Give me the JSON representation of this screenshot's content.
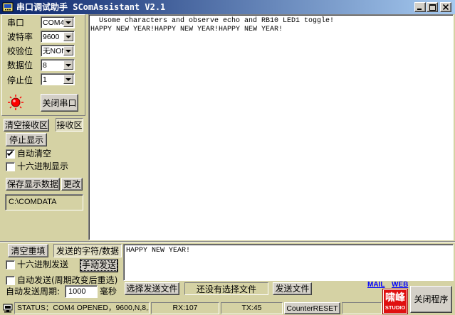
{
  "window": {
    "title": "串口调试助手 SComAssistant V2.1"
  },
  "icons": {
    "app": "app-icon",
    "minimize": "minimize-icon",
    "maximize": "maximize-icon",
    "close": "close-icon",
    "dropdown": "dropdown-arrow-icon",
    "led": "led-indicator-icon",
    "checkmark": "checkmark-icon",
    "status": "status-icon"
  },
  "colors": {
    "panel": "#d5d2a4",
    "button_face": "#d4d0c8",
    "title_start": "#0a246a",
    "title_end": "#a6caf0",
    "led": "#ff0000",
    "link": "#0000ff",
    "logo": "#e01010"
  },
  "port_settings": {
    "fields": [
      {
        "label": "串口",
        "value": "COM4"
      },
      {
        "label": "波特率",
        "value": "9600"
      },
      {
        "label": "校验位",
        "value": "无NON"
      },
      {
        "label": "数据位",
        "value": "8"
      },
      {
        "label": "停止位",
        "value": "1"
      }
    ],
    "close_port_button": "关闭串口"
  },
  "receive": {
    "clear_button": "清空接收区",
    "area_label": "接收区",
    "stop_display_button": "停止显示",
    "auto_clear": {
      "label": "自动清空",
      "checked": true
    },
    "hex_display": {
      "label": "十六进制显示",
      "checked": false
    },
    "save_button": "保存显示数据",
    "change_button": "更改",
    "save_path": "C:\\COMDATA",
    "lines": [
      "  Usome characters and observe echo and RB10 LED1 toggle!",
      "HAPPY NEW YEAR!HAPPY NEW YEAR!HAPPY NEW YEAR!"
    ]
  },
  "send": {
    "clear_button": "清空重填",
    "area_label": "发送的字符/数据",
    "text": "HAPPY NEW YEAR!",
    "hex_send": {
      "label": "十六进制发送",
      "checked": false
    },
    "manual_send_button": "手动发送",
    "auto_send": {
      "label": "自动发送(周期改变后重选)",
      "checked": false
    },
    "period_label": "自动发送周期:",
    "period_value": "1000",
    "period_unit": "毫秒",
    "select_file_button": "选择发送文件",
    "file_status": "还没有选择文件",
    "send_file_button": "发送文件"
  },
  "links": {
    "mail": "MAIL",
    "web": "WEB"
  },
  "logo": {
    "line1": "啸峰",
    "line2": "STUDIO"
  },
  "exit_button": "关闭程序",
  "status_bar": {
    "status": "STATUS：COM4 OPENED，9600,N,8,1",
    "rx": "RX:107",
    "tx": "TX:45",
    "reset_button": "CounterRESET"
  }
}
